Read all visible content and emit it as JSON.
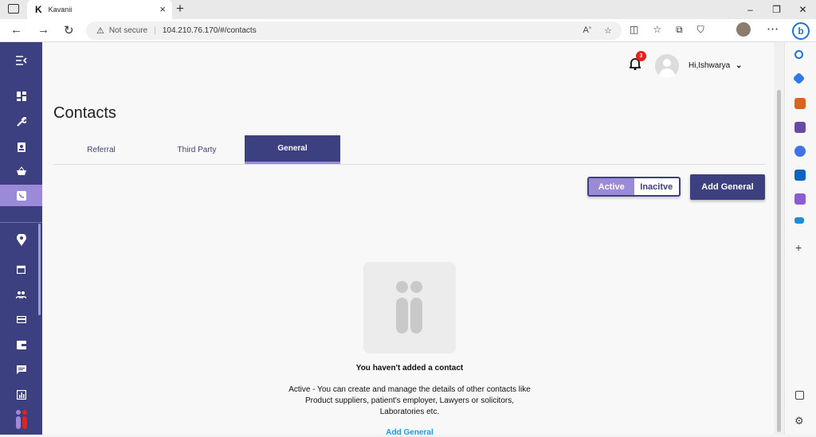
{
  "browser": {
    "tab_title": "Kavanii",
    "tab_logo": "K",
    "new_tab": "+",
    "security_label": "Not secure",
    "url": "104.210.76.170/#/contacts",
    "window_controls": [
      "–",
      "❐",
      "✕"
    ]
  },
  "header": {
    "notification_count": "3",
    "greeting": "Hi,Ishwarya"
  },
  "page": {
    "title": "Contacts",
    "tabs": [
      {
        "label": "Referral"
      },
      {
        "label": "Third Party"
      },
      {
        "label": "General"
      }
    ],
    "selected_tab": "General"
  },
  "toolbar": {
    "active_label": "Active",
    "inactive_label": "Inacitve",
    "add_button": "Add General"
  },
  "empty_state": {
    "title": "You haven't added a contact",
    "description_line1": "Active - You can create and manage the details of other contacts like",
    "description_line2": "Product suppliers, patient's employer, Lawyers or solicitors,",
    "description_line3": "Laboratories etc.",
    "link": "Add General"
  },
  "colors": {
    "primary": "#3c3f80",
    "accent": "#9b8ad8",
    "link": "#1e9be6",
    "badge": "#e2231a"
  }
}
